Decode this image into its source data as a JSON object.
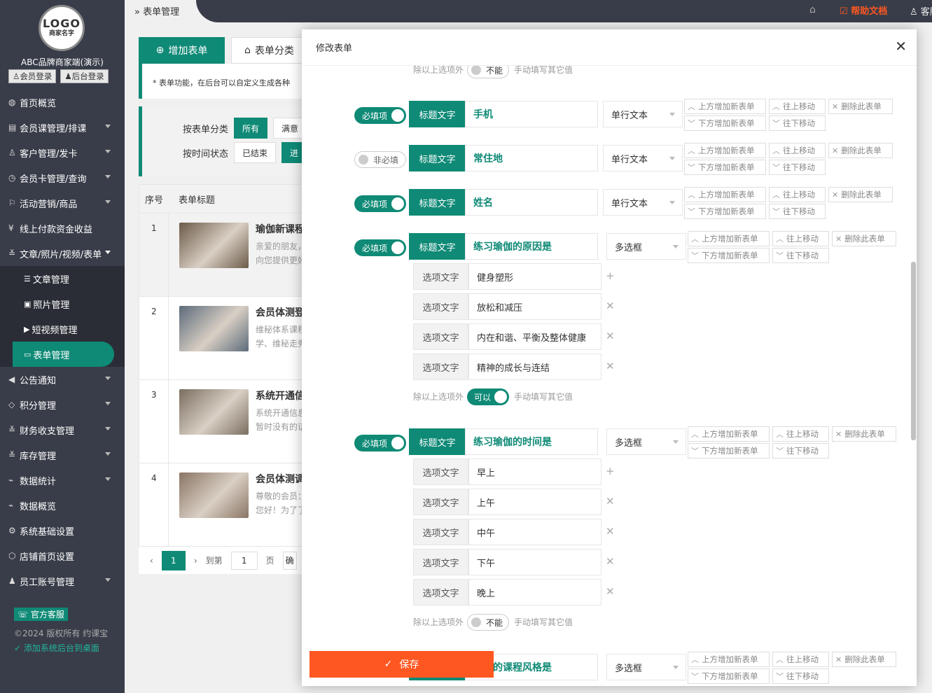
{
  "sidebar": {
    "logo_main": "LOGO",
    "logo_sub": "商家名字",
    "brand": "ABC品牌商家端(演示)",
    "member_login": "会员登录",
    "admin_login": "后台登录",
    "items": [
      {
        "icon": "globe-icon",
        "glyph": "◍",
        "label": "首页概览",
        "arrow": false
      },
      {
        "icon": "calendar-icon",
        "glyph": "▤",
        "label": "会员课管理/排课",
        "arrow": true
      },
      {
        "icon": "user-icon",
        "glyph": "♙",
        "label": "客户管理/发卡",
        "arrow": true
      },
      {
        "icon": "clock-icon",
        "glyph": "◷",
        "label": "会员卡管理/查询",
        "arrow": true
      },
      {
        "icon": "flag-icon",
        "glyph": "⚐",
        "label": "活动营销/商品",
        "arrow": true
      },
      {
        "icon": "yen-icon",
        "glyph": "¥",
        "label": "线上付款资金收益",
        "arrow": false
      },
      {
        "icon": "sliders-icon",
        "glyph": "≚",
        "label": "文章/照片/视频/表单",
        "arrow": true,
        "open": true
      }
    ],
    "subitems": [
      {
        "icon": "list-icon",
        "glyph": "☰",
        "label": "文章管理"
      },
      {
        "icon": "image-icon",
        "glyph": "▣",
        "label": "照片管理"
      },
      {
        "icon": "play-icon",
        "glyph": "▶",
        "label": "短视频管理"
      },
      {
        "icon": "form-icon",
        "glyph": "▭",
        "label": "表单管理",
        "active": true
      }
    ],
    "items2": [
      {
        "icon": "speaker-icon",
        "glyph": "◀",
        "label": "公告通知",
        "arrow": true
      },
      {
        "icon": "diamond-icon",
        "glyph": "◇",
        "label": "积分管理",
        "arrow": true
      },
      {
        "icon": "sliders-icon",
        "glyph": "≚",
        "label": "财务收支管理",
        "arrow": true
      },
      {
        "icon": "sliders-icon",
        "glyph": "≚",
        "label": "库存管理",
        "arrow": true
      },
      {
        "icon": "pulse-icon",
        "glyph": "⌁",
        "label": "数据统计",
        "arrow": true
      },
      {
        "icon": "pulse-icon",
        "glyph": "⌁",
        "label": "数据概览",
        "arrow": false
      },
      {
        "icon": "gear-icon",
        "glyph": "⚙",
        "label": "系统基础设置",
        "arrow": false
      },
      {
        "icon": "cube-icon",
        "glyph": "⬡",
        "label": "店铺首页设置",
        "arrow": false
      },
      {
        "icon": "person-icon",
        "glyph": "♟",
        "label": "员工账号管理",
        "arrow": true
      }
    ],
    "service": "官方客服",
    "copyright": "©2024 版权所有 约课宝",
    "desktop": "添加系统后台到桌面"
  },
  "topbar": {
    "breadcrumb": "表单管理",
    "help": "帮助文档",
    "customer": "客服"
  },
  "page": {
    "add_form": "增加表单",
    "form_category": "表单分类",
    "notice": "* 表单功能，在后台可以自定义生成各种",
    "filter_cat_label": "按表单分类",
    "filter_cat_all": "所有",
    "filter_cat_full": "满意",
    "filter_time_label": "按时间状态",
    "filter_time_ended": "已结束",
    "filter_time_ongoing": "进",
    "col_index": "序号",
    "col_title": "表单标题",
    "rows": [
      {
        "idx": "1",
        "title": "瑜伽新课程",
        "d1": "亲爱的朋友，",
        "d2": "向您提供更好",
        "color": "#6b5a48"
      },
      {
        "idx": "2",
        "title": "会员体测登",
        "d1": "维秘体系课程",
        "d2": "学、维秘走秀",
        "color": "#5c6b7a"
      },
      {
        "idx": "3",
        "title": "系统开通信",
        "d1": "系统开通信息",
        "d2": "暂时没有的话",
        "color": "#7a6e60"
      },
      {
        "idx": "4",
        "title": "会员体测调",
        "d1": "尊敬的会员：",
        "d2": "您好！为了了",
        "color": "#8a7565"
      }
    ],
    "pager_current": "1",
    "pager_goto": "到第",
    "pager_input": "1",
    "pager_page": "页",
    "pager_confirm": "确"
  },
  "modal": {
    "title": "修改表单",
    "required_on": "必填项",
    "required_off": "非必填",
    "title_label": "标题文字",
    "option_label": "选项文字",
    "except_text": "除以上选项外",
    "manual_text": "手动填写其它值",
    "cannot": "不能",
    "can": "可以",
    "add_above": "上方增加新表单",
    "move_up": "往上移动",
    "delete": "删除此表单",
    "add_below": "下方增加新表单",
    "move_down": "往下移动",
    "fields": [
      {
        "title": "手机",
        "type": "单行文本",
        "required": true
      },
      {
        "title": "常住地",
        "type": "单行文本",
        "required": false
      },
      {
        "title": "姓名",
        "type": "单行文本",
        "required": true
      },
      {
        "title": "练习瑜伽的原因是",
        "type": "多选框",
        "required": true,
        "options": [
          "健身塑形",
          "放松和减压",
          "内在和谐、平衡及整体健康",
          "精神的成长与连结"
        ],
        "other_allowed": true
      },
      {
        "title": "练习瑜伽的时间是",
        "type": "多选框",
        "required": true,
        "options": [
          "早上",
          "上午",
          "中午",
          "下午",
          "晚上"
        ],
        "other_allowed": false
      },
      {
        "title": "喜欢的课程风格是",
        "type": "多选框",
        "required": true
      }
    ],
    "save": "保存"
  },
  "colors": {
    "primary": "#0f8a76",
    "accent": "#ff5722",
    "sidebar": "#393d49"
  }
}
